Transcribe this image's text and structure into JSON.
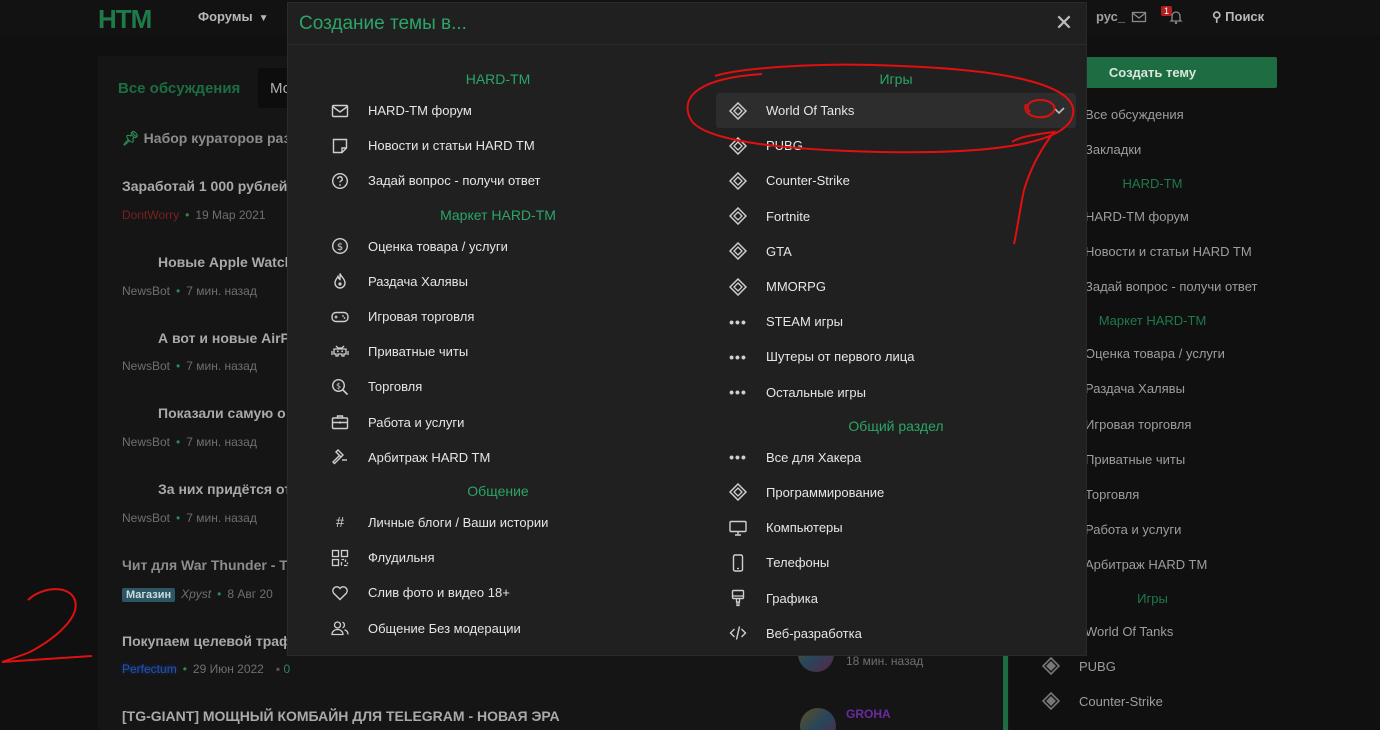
{
  "header": {
    "logo": "HTM",
    "forums_label": "Форумы",
    "user_label": "рус_",
    "notification_count": "1",
    "search_label": "Поиск"
  },
  "background": {
    "tab_all": "Все обсуждения",
    "tab_partial": "Мо",
    "pinned": "Набор кураторов разд",
    "threads": [
      {
        "title": "Заработай 1 000 рублей",
        "author": "DontWorry",
        "date": "19 Мар 2021"
      },
      {
        "title": "Новые Apple Watch",
        "author": "NewsBot",
        "date": "7 мин. назад"
      },
      {
        "title": "А вот и новые AirP",
        "author": "NewsBot",
        "date": "7 мин. назад"
      },
      {
        "title": "Показали самую о",
        "author": "NewsBot",
        "date": "7 мин. назад"
      },
      {
        "title": "За них придётся от",
        "author": "NewsBot",
        "date": "7 мин. назад"
      },
      {
        "title": "Чит для War Thunder - T",
        "tag": "Магазин",
        "author": "Xpyst",
        "date": "8 Авг 20"
      },
      {
        "title": "Покупаем целевой траф",
        "author": "Perfectum",
        "date": "29 Июн 2022",
        "replies": "0",
        "last_time": "18 мин. назад"
      },
      {
        "title": "[TG-GIANT] МОЩНЫЙ КОМБАЙН ДЛЯ TELEGRAM - НОВАЯ ЭРА",
        "last_user": "GROHA"
      }
    ]
  },
  "sidebar": {
    "create_button": "Создать тему",
    "items_top": [
      "Все обсуждения",
      "Закладки"
    ],
    "head_hardtm": "HARD-TM",
    "items_hardtm": [
      "HARD-TM форум",
      "Новости и статьи HARD TM",
      "Задай вопрос - получи ответ"
    ],
    "head_market": "Маркет HARD-TM",
    "items_market": [
      "Оценка товара / услуги",
      "Раздача Халявы",
      "Игровая торговля",
      "Приватные читы",
      "Торговля",
      "Работа и услуги",
      "Арбитраж HARD TM"
    ],
    "head_games": "Игры",
    "items_games": [
      "World Of Tanks",
      "PUBG",
      "Counter-Strike"
    ]
  },
  "modal": {
    "title": "Создание темы в...",
    "left": {
      "sec1": "HARD-TM",
      "sec1_items": [
        "HARD-TM форум",
        "Новости и статьи HARD TM",
        "Задай вопрос - получи ответ"
      ],
      "sec2": "Маркет HARD-TM",
      "sec2_items": [
        "Оценка товара / услуги",
        "Раздача Халявы",
        "Игровая торговля",
        "Приватные читы",
        "Торговля",
        "Работа и услуги",
        "Арбитраж HARD TM"
      ],
      "sec3": "Общение",
      "sec3_items": [
        "Личные блоги / Ваши истории",
        "Флудильня",
        "Слив фото и видео 18+",
        "Общение Без модерации"
      ]
    },
    "right": {
      "sec1": "Игры",
      "sec1_items": [
        "World Of Tanks",
        "PUBG",
        "Counter-Strike",
        "Fortnite",
        "GTA",
        "MMORPG",
        "STEAM игры",
        "Шутеры от первого лица",
        "Остальные игры"
      ],
      "sec2": "Общий раздел",
      "sec2_items": [
        "Все для Хакера",
        "Программирование",
        "Компьютеры",
        "Телефоны",
        "Графика",
        "Веб-разработка"
      ]
    }
  },
  "colors": {
    "accent": "#2ba567",
    "modal_bg": "#202020",
    "annotation": "#e01010"
  }
}
